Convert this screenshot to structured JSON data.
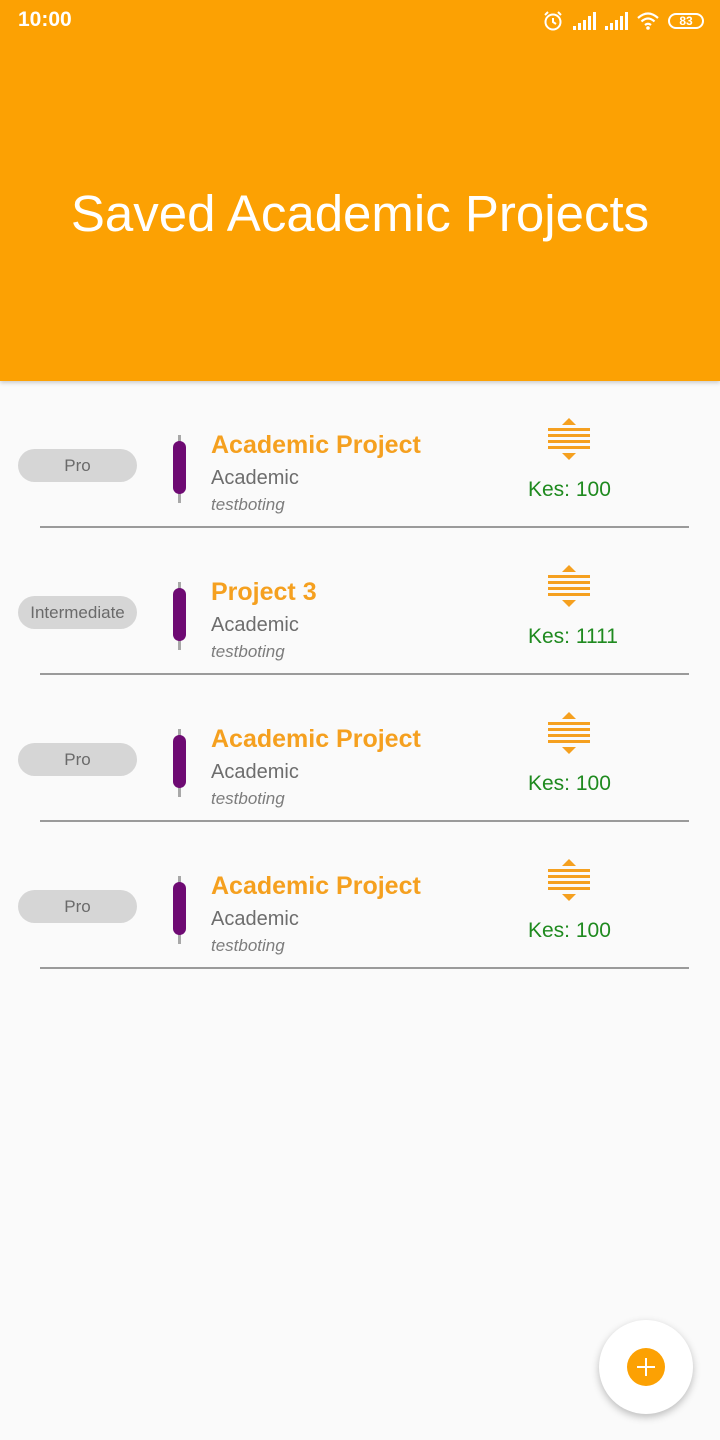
{
  "status_bar": {
    "time": "10:00",
    "battery": "83",
    "icons": [
      "alarm-icon",
      "signal-icon",
      "signal-icon",
      "wifi-icon",
      "battery-icon"
    ]
  },
  "header": {
    "title": "Saved Academic Projects"
  },
  "projects": [
    {
      "level": "Pro",
      "title": "Academic Project",
      "category": "Academic",
      "author": "testboting",
      "price": "Kes: 100"
    },
    {
      "level": "Intermediate",
      "title": "Project 3",
      "category": "Academic",
      "author": "testboting",
      "price": "Kes: 1111"
    },
    {
      "level": "Pro",
      "title": "Academic Project",
      "category": "Academic",
      "author": "testboting",
      "price": "Kes: 100"
    },
    {
      "level": "Pro",
      "title": "Academic Project",
      "category": "Academic",
      "author": "testboting",
      "price": "Kes: 100"
    }
  ],
  "fab": {
    "icon": "add-icon"
  },
  "colors": {
    "accent": "#fca103",
    "title": "#f5a01f",
    "price": "#1f8a1f",
    "bar": "#6e0a73"
  }
}
